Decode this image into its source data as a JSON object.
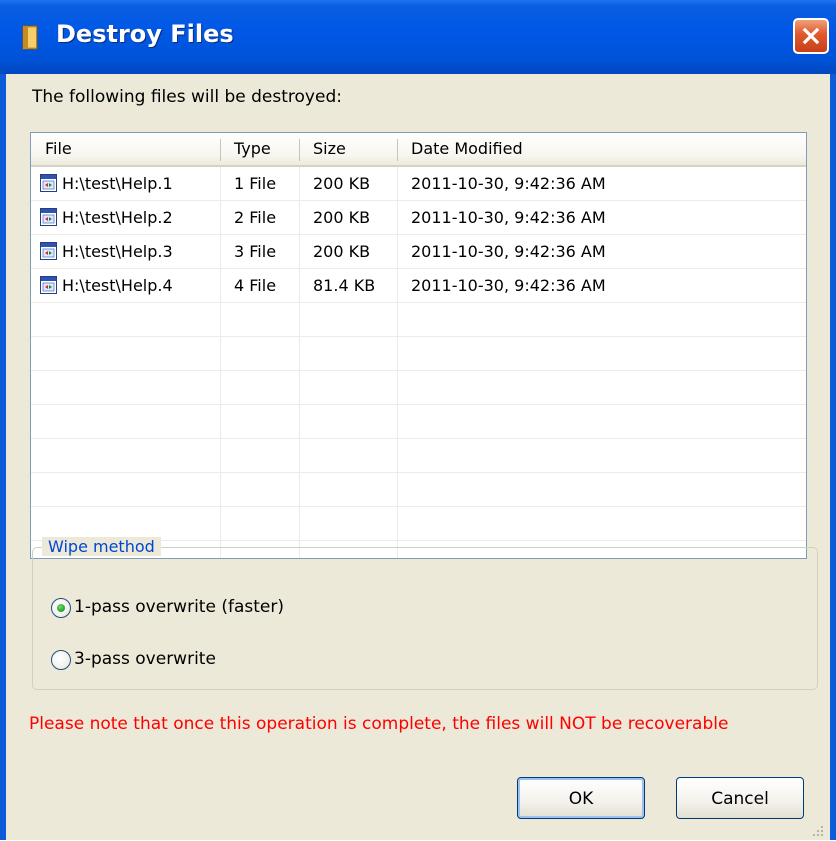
{
  "window": {
    "title": "Destroy Files",
    "close_icon": "close-icon"
  },
  "intro_text": "The following files will be destroyed:",
  "table": {
    "columns": [
      "File",
      "Type",
      "Size",
      "Date Modified"
    ],
    "rows": [
      {
        "file": "H:\\test\\Help.1",
        "type": "1 File",
        "size": "200 KB",
        "modified": "2011-10-30, 9:42:36 AM",
        "icon": "file-icon"
      },
      {
        "file": "H:\\test\\Help.2",
        "type": "2 File",
        "size": "200 KB",
        "modified": "2011-10-30, 9:42:36 AM",
        "icon": "file-icon"
      },
      {
        "file": "H:\\test\\Help.3",
        "type": "3 File",
        "size": "200 KB",
        "modified": "2011-10-30, 9:42:36 AM",
        "icon": "file-icon"
      },
      {
        "file": "H:\\test\\Help.4",
        "type": "4 File",
        "size": "81.4 KB",
        "modified": "2011-10-30, 9:42:36 AM",
        "icon": "file-icon"
      }
    ]
  },
  "wipe_method": {
    "label": "Wipe method",
    "options": [
      {
        "label": "1-pass overwrite (faster)",
        "selected": true
      },
      {
        "label": "3-pass overwrite",
        "selected": false
      }
    ]
  },
  "warning_text": "Please note that once this operation is complete, the files will NOT be recoverable",
  "buttons": {
    "ok": "OK",
    "cancel": "Cancel"
  },
  "colors": {
    "titlebar": "#0058e6",
    "dialog_bg": "#ece9d8",
    "warning": "#ff0000",
    "group_label": "#0046d5"
  }
}
